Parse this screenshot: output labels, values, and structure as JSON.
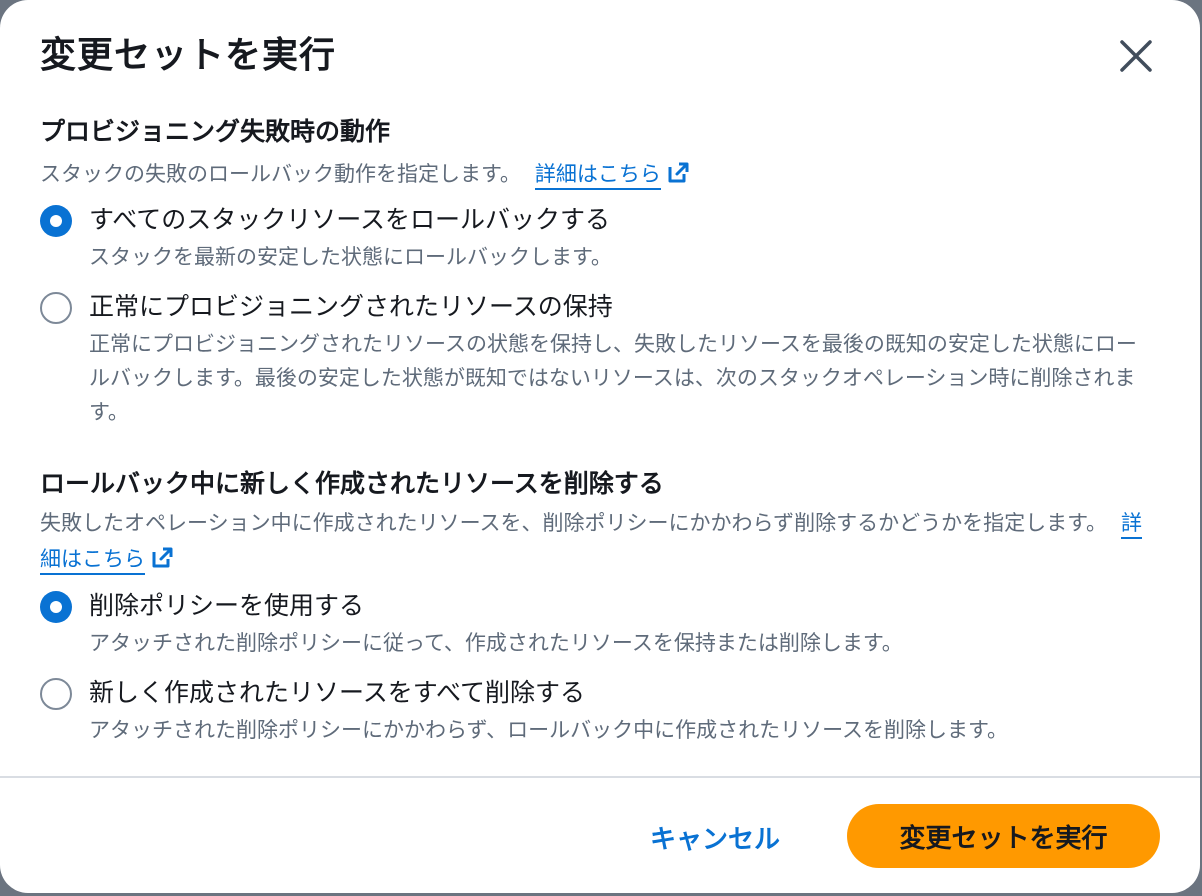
{
  "modal": {
    "title": "変更セットを実行",
    "close_icon": "close-icon"
  },
  "provisioning_failure": {
    "title": "プロビジョニング失敗時の動作",
    "description": "スタックの失敗のロールバック動作を指定します。",
    "learn_more": "詳細はこちら",
    "options": [
      {
        "label": "すべてのスタックリソースをロールバックする",
        "description": "スタックを最新の安定した状態にロールバックします。",
        "selected": true
      },
      {
        "label": "正常にプロビジョニングされたリソースの保持",
        "description": "正常にプロビジョニングされたリソースの状態を保持し、失敗したリソースを最後の既知の安定した状態にロールバックします。最後の安定した状態が既知ではないリソースは、次のスタックオペレーション時に削除されます。",
        "selected": false
      }
    ]
  },
  "rollback_delete": {
    "title": "ロールバック中に新しく作成されたリソースを削除する",
    "description": "失敗したオペレーション中に作成されたリソースを、削除ポリシーにかかわらず削除するかどうかを指定します。",
    "learn_more": "詳細はこちら",
    "options": [
      {
        "label": "削除ポリシーを使用する",
        "description": "アタッチされた削除ポリシーに従って、作成されたリソースを保持または削除します。",
        "selected": true
      },
      {
        "label": "新しく作成されたリソースをすべて削除する",
        "description": "アタッチされた削除ポリシーにかかわらず、ロールバック中に作成されたリソースを削除します。",
        "selected": false
      }
    ]
  },
  "footer": {
    "cancel_label": "キャンセル",
    "submit_label": "変更セットを実行"
  },
  "colors": {
    "accent": "#0972d3",
    "primary_button": "#ff9900",
    "text": "#16191f",
    "muted_text": "#5f6b7a"
  }
}
